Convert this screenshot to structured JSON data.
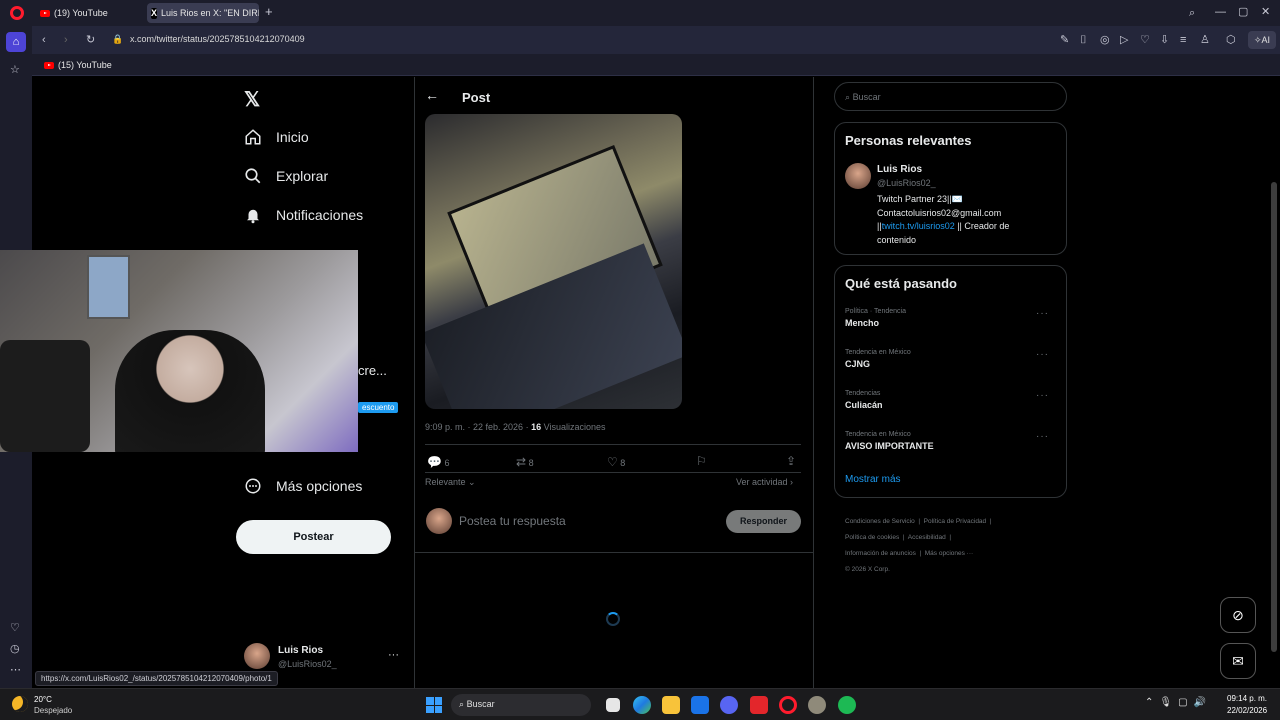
{
  "browser": {
    "tabs": [
      {
        "label": "(19) YouTube",
        "active": false
      },
      {
        "label": "Luis Rios en X: \"EN DIRECTO",
        "active": true
      }
    ],
    "url": "x.com/twitter/status/2025785104212070409",
    "bookmark": "(15) YouTube",
    "ai_label": "AI",
    "status_url": "https://x.com/LuisRios02_/status/2025785104212070409/photo/1"
  },
  "nav": {
    "items": [
      {
        "label": "Inicio"
      },
      {
        "label": "Explorar"
      },
      {
        "label": "Notificaciones"
      },
      {
        "label": "Más opciones"
      }
    ],
    "partial_label": "cre...",
    "badge": "escuento",
    "post_button": "Postear",
    "account": {
      "name": "Luis Rios",
      "handle": "@LuisRios02_"
    }
  },
  "post": {
    "header_title": "Post",
    "time": "9:09 p. m. · 22 feb. 2026 ·",
    "views_count": "16",
    "views_label": "Visualizaciones",
    "replies": "6",
    "reposts": "8",
    "likes": "8",
    "sort_label": "Relevante",
    "activity_label": "Ver actividad",
    "reply_placeholder": "Postea tu respuesta",
    "reply_button": "Responder"
  },
  "search": {
    "placeholder": "Buscar"
  },
  "relevant": {
    "title": "Personas relevantes",
    "name": "Luis Rios",
    "handle": "@LuisRios02_",
    "bio_line1": "Twitch Partner 23||✉️",
    "bio_line2": "Contactoluisrios02@gmail.com",
    "bio_link_prefix": "||",
    "bio_link": "twitch.tv/luisrios02",
    "bio_suffix": " || Creador de",
    "bio_line4": "contenido"
  },
  "trends": {
    "title": "Qué está pasando",
    "items": [
      {
        "category": "Política · Tendencia",
        "name": "Mencho"
      },
      {
        "category": "Tendencia en México",
        "name": "CJNG"
      },
      {
        "category": "Tendencias",
        "name": "Culiacán"
      },
      {
        "category": "Tendencia en México",
        "name": "AVISO IMPORTANTE"
      }
    ],
    "show_more": "Mostrar más"
  },
  "footer": {
    "links": [
      "Condiciones de Servicio",
      "Política de Privacidad",
      "Política de cookies",
      "Accesibilidad",
      "Información de anuncios",
      "Más opciones ···"
    ],
    "copyright": "© 2026 X Corp."
  },
  "taskbar": {
    "weather_temp": "20°C",
    "weather_desc": "Despejado",
    "search_label": "Buscar",
    "time": "09:14 p. m.",
    "date": "22/02/2026"
  }
}
